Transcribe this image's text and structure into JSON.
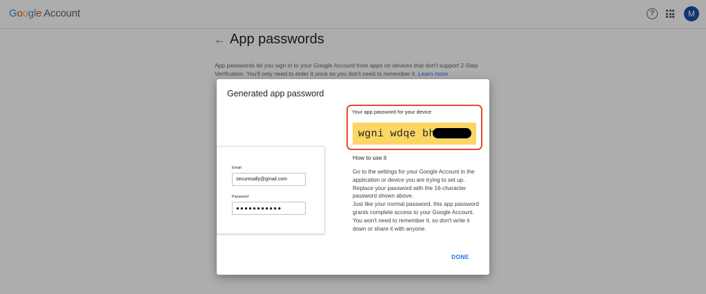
{
  "header": {
    "logo": {
      "letters": [
        "G",
        "o",
        "o",
        "g",
        "l",
        "e"
      ],
      "product": "Account"
    },
    "help_icon": "help-circle-icon",
    "apps_icon": "apps-grid-icon",
    "avatar_initial": "M",
    "avatar_color": "#1a4fa8"
  },
  "page": {
    "back_icon": "←",
    "title": "App passwords",
    "description": "App passwords let you sign in to your Google Account from apps on devices that don't support 2-Step Verification. You'll only need to enter it once so you don't need to remember it.",
    "learn_more": "Learn more"
  },
  "dialog": {
    "title": "Generated app password",
    "mock_form": {
      "email_label": "Email",
      "email_value": "securesally@gmail.com",
      "password_label": "Password",
      "password_value": "●●●●●●●●●●●"
    },
    "password_heading": "Your app password for your device",
    "password_value": "wgni wdqe bhf",
    "highlight_color": "#e8452c",
    "field_color": "#fcd665",
    "howto_title": "How to use it",
    "howto_text": "Go to the settings for your Google Account in the application or device you are trying to set up. Replace your password with the 16-character password shown above.",
    "howto_text2": "Just like your normal password, this app password grants complete access to your Google Account. You won't need to remember it, so don't write it down or share it with anyone.",
    "done_label": "DONE"
  }
}
